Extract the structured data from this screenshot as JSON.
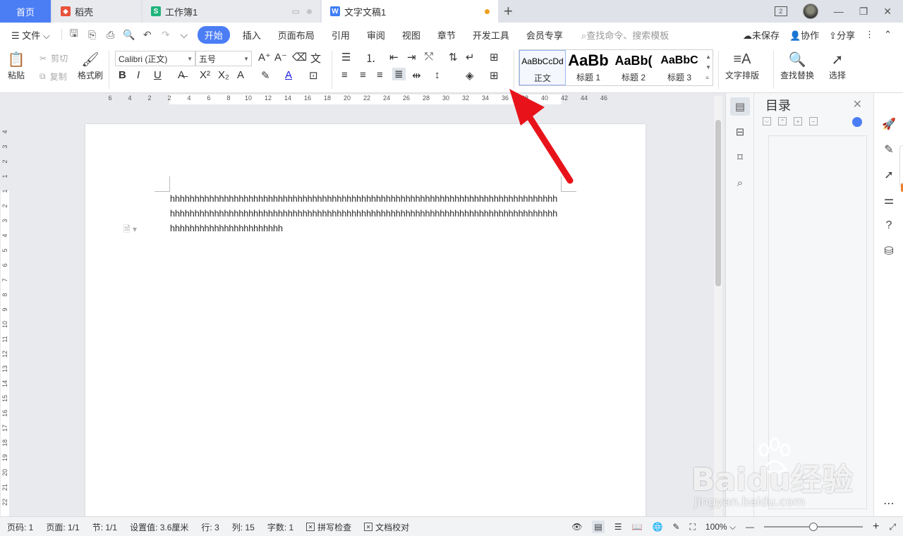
{
  "tabs": {
    "home": "首页",
    "daoke": "稻壳",
    "sheet": "工作簿1",
    "doc": "文字文稿1",
    "window_badge": "2"
  },
  "menu": {
    "file": "文件",
    "items": [
      "开始",
      "插入",
      "页面布局",
      "引用",
      "审阅",
      "视图",
      "章节",
      "开发工具",
      "会员专享"
    ],
    "search_placeholder": "查找命令、搜索模板",
    "unsaved": "未保存",
    "collab": "协作",
    "share": "分享"
  },
  "ribbon": {
    "paste": "粘贴",
    "cut": "剪切",
    "copy": "复制",
    "format_painter": "格式刷",
    "font_name": "Calibri (正文)",
    "font_size": "五号",
    "styles": [
      {
        "sample": "AaBbCcDd",
        "name": "正文"
      },
      {
        "sample": "AaBb",
        "name": "标题 1"
      },
      {
        "sample": "AaBb(",
        "name": "标题 2"
      },
      {
        "sample": "AaBbC",
        "name": "标题 3"
      }
    ],
    "text_layout": "文字排版",
    "find_replace": "查找替换",
    "select": "选择"
  },
  "ruler": {
    "h_ticks": [
      "6",
      "4",
      "2",
      "2",
      "4",
      "6",
      "8",
      "10",
      "12",
      "14",
      "16",
      "18",
      "20",
      "22",
      "24",
      "26",
      "28",
      "30",
      "32",
      "34",
      "36",
      "38",
      "40",
      "42",
      "44",
      "46"
    ],
    "v_ticks": [
      "4",
      "3",
      "2",
      "1",
      "1",
      "2",
      "3",
      "4",
      "5",
      "6",
      "7",
      "8",
      "9",
      "10",
      "11",
      "12",
      "13",
      "14",
      "15",
      "16",
      "17",
      "18",
      "19",
      "20",
      "21",
      "22"
    ]
  },
  "document": {
    "text": "hhhhhhhhhhhhhhhhhhhhhhhhhhhhhhhhhhhhhhhhhhhhhhhhhhhhhhhhhhhhhhhhhhhhhhhhhhhhhhhhhhhhhhhhhhhhhhhhhhhhhhhhhhhhhhhhhhhhhhhhhhhhhhhhhhhhhhhhhhhhhhhhhhhhhhhhhhhhhhhhhhhhhhhhhhhhhhhhhhhhh"
  },
  "nav_panel": {
    "title": "目录"
  },
  "status": {
    "page_num": "页码: 1",
    "pages": "页面: 1/1",
    "section": "节: 1/1",
    "setting": "设置值: 3.6厘米",
    "row": "行: 3",
    "col": "列: 15",
    "word_count": "字数: 1",
    "spell_check": "拼写检查",
    "doc_proof": "文档校对",
    "zoom": "100%",
    "zoom_fraction": 0.5
  },
  "watermark": {
    "brand": "Baidu经验",
    "url": "jingyan.baidu.com"
  },
  "colors": {
    "accent": "#4b7df5",
    "arrow": "#e8131a"
  }
}
